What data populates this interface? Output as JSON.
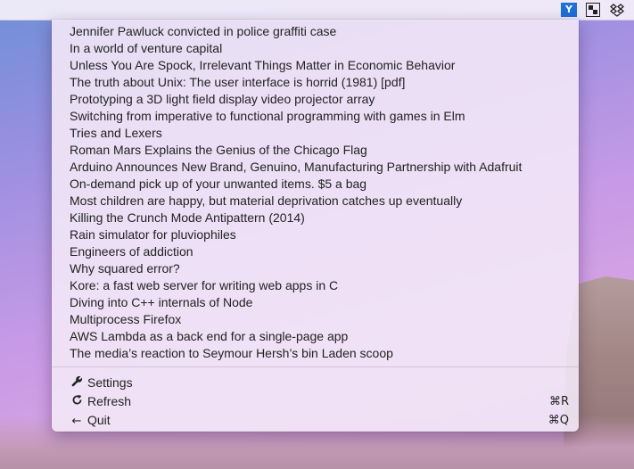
{
  "menubar": {
    "icons": [
      "hacker-news-icon",
      "grid-icon",
      "dropbox-icon"
    ],
    "hn_label": "Y",
    "accent_color": "#1f6fd6"
  },
  "stories": [
    "Jennifer Pawluck convicted in police graffiti case",
    "In a world of venture capital",
    "Unless You Are Spock, Irrelevant Things Matter in Economic Behavior",
    "The truth about Unix: The user interface is horrid (1981) [pdf]",
    "Prototyping a 3D light field display video projector array",
    "Switching from imperative to functional programming with games in Elm",
    "Tries and Lexers",
    "Roman Mars Explains the Genius of the Chicago Flag",
    "Arduino Announces New Brand, Genuino, Manufacturing Partnership with Adafruit",
    "On-demand pick up of your unwanted items. $5 a bag",
    "Most children are happy, but material deprivation catches up eventually",
    "Killing the Crunch Mode Antipattern (2014)",
    "Rain simulator for pluviophiles",
    "Engineers of addiction",
    "Why squared error?",
    "Kore: a fast web server for writing web apps in C",
    "Diving into C++ internals of Node",
    "Multiprocess Firefox",
    "AWS Lambda as a back end for a single-page app",
    "The media’s reaction to Seymour Hersh’s bin Laden scoop"
  ],
  "actions": {
    "settings": {
      "label": "Settings",
      "icon": "wrench-icon",
      "glyph": "🔧"
    },
    "refresh": {
      "label": "Refresh",
      "icon": "refresh-icon",
      "glyph": "⟳",
      "shortcut": "⌘R"
    },
    "quit": {
      "label": "Quit",
      "icon": "arrow-left-icon",
      "glyph": "←",
      "shortcut": "⌘Q"
    }
  }
}
